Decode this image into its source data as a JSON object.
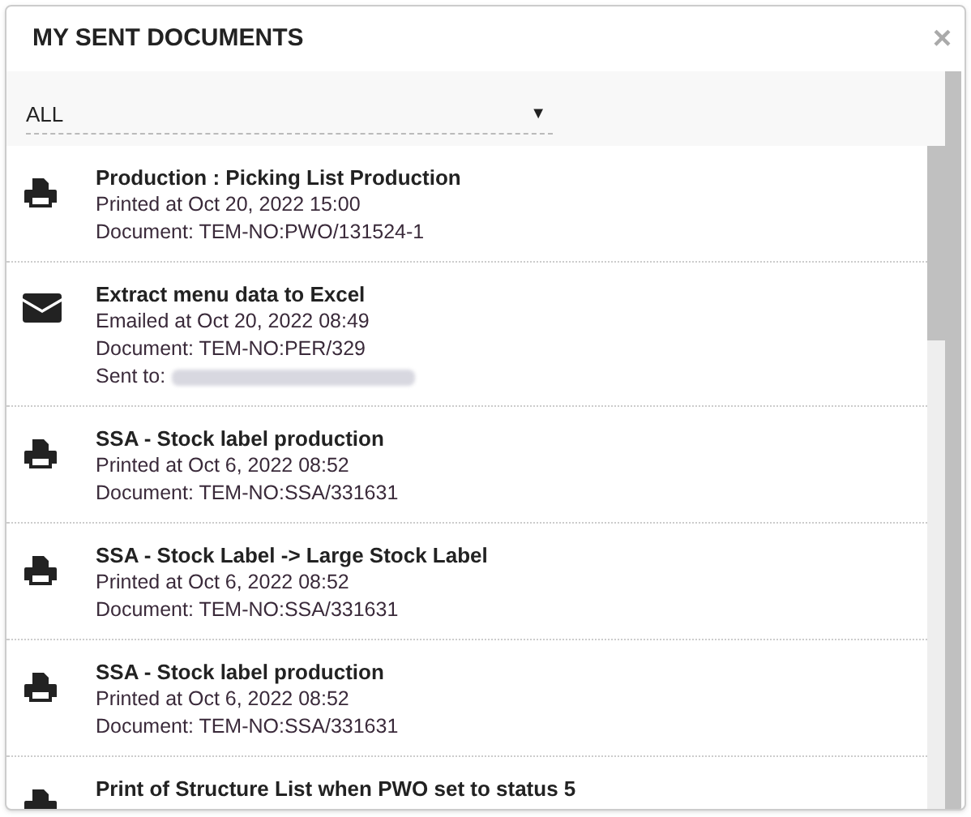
{
  "dialog": {
    "title": "MY SENT DOCUMENTS",
    "close": "×"
  },
  "filter": {
    "value": "ALL",
    "caret": "▼"
  },
  "documents": [
    {
      "kind": "print",
      "title": "Production : Picking List Production",
      "lines": [
        "Printed at Oct 20, 2022 15:00",
        "Document: TEM-NO:PWO/131524-1"
      ]
    },
    {
      "kind": "email",
      "title": "Extract menu data to Excel",
      "lines": [
        "Emailed at Oct 20, 2022 08:49",
        "Document: TEM-NO:PER/329"
      ],
      "sent_to_label": "Sent to:"
    },
    {
      "kind": "print",
      "title": "SSA - Stock label production",
      "lines": [
        "Printed at Oct 6, 2022 08:52",
        "Document: TEM-NO:SSA/331631"
      ]
    },
    {
      "kind": "print",
      "title": "SSA - Stock Label -> Large Stock Label",
      "lines": [
        "Printed at Oct 6, 2022 08:52",
        "Document: TEM-NO:SSA/331631"
      ]
    },
    {
      "kind": "print",
      "title": "SSA - Stock label production",
      "lines": [
        "Printed at Oct 6, 2022 08:52",
        "Document: TEM-NO:SSA/331631"
      ]
    },
    {
      "kind": "print",
      "title": "Print of Structure List when PWO set to status 5"
    }
  ]
}
